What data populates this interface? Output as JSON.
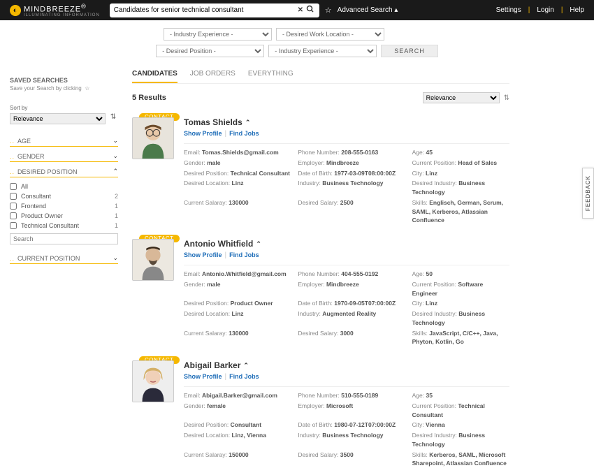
{
  "header": {
    "brand": "MINDBREEZE",
    "tagline": "ILLUMINATING INFORMATION",
    "search_value": "Candidates for senior technical consultant",
    "adv_search": "Advanced Search",
    "nav": {
      "settings": "Settings",
      "login": "Login",
      "help": "Help"
    }
  },
  "filters": {
    "f1": "- Industry Experience -",
    "f2": "- Desired Work Location -",
    "f3": "- Desired Position -",
    "f4": "- Industry Experience -",
    "button": "SEARCH"
  },
  "sidebar": {
    "saved": "SAVED SEARCHES",
    "saved_hint": "Save your Search by clicking",
    "sort_label": "Sort by",
    "sort_value": "Relevance",
    "facets": {
      "age": "AGE",
      "gender": "GENDER",
      "desired": "DESIRED POSITION",
      "current": "CURRENT POSITION"
    },
    "desired_opts": [
      {
        "label": "All",
        "count": ""
      },
      {
        "label": "Consultant",
        "count": "2"
      },
      {
        "label": "Frontend",
        "count": "1"
      },
      {
        "label": "Product Owner",
        "count": "1"
      },
      {
        "label": "Technical Consultant",
        "count": "1"
      }
    ],
    "search_ph": "Search"
  },
  "tabs": {
    "candidates": "CANDIDATES",
    "joborders": "JOB ORDERS",
    "everything": "EVERYTHING"
  },
  "results_header": {
    "count": "5 Results",
    "sort": "Relevance"
  },
  "feedback": "FEEDBACK",
  "contact_badge": "CONTACT",
  "links": {
    "show": "Show Profile",
    "find": "Find Jobs"
  },
  "labels": {
    "email": "Email:",
    "phone": "Phone Number:",
    "age": "Age:",
    "gender": "Gender:",
    "employer": "Employer:",
    "curpos": "Current Position:",
    "despos": "Desired Position:",
    "dob": "Date of Birth:",
    "city": "City:",
    "desloc": "Desired Location:",
    "industry": "Industry:",
    "desind": "Desired Industry:",
    "cursal": "Current Salaray:",
    "dessal": "Desired Salary:",
    "skills": "Skills:"
  },
  "candidates": [
    {
      "name": "Tomas Shields",
      "email": "Tomas.Shields@gmail.com",
      "phone": "208-555-0163",
      "age": "45",
      "gender": "male",
      "employer": "Mindbreeze",
      "curpos": "Head of Sales",
      "despos": "Technical Consultant",
      "dob": "1977-03-09T08:00:00Z",
      "city": "Linz",
      "desloc": "Linz",
      "industry": "Business Technology",
      "desind": "Business Technology",
      "cursal": "130000",
      "dessal": "2500",
      "skills": "Englisch, German, Scrum, SAML, Kerberos, Atlassian Confluence"
    },
    {
      "name": "Antonio Whitfield",
      "email": "Antonio.Whitfield@gmail.com",
      "phone": "404-555-0192",
      "age": "50",
      "gender": "male",
      "employer": "Mindbreeze",
      "curpos": "Software Engineer",
      "despos": "Product Owner",
      "dob": "1970-09-05T07:00:00Z",
      "city": "Linz",
      "desloc": "Linz",
      "industry": "Augmented Reality",
      "desind": "Business Technology",
      "cursal": "130000",
      "dessal": "3000",
      "skills": "JavaScript, C/C++, Java, Phyton, Kotlin, Go"
    },
    {
      "name": "Abigail Barker",
      "email": "Abigail.Barker@gmail.com",
      "phone": "510-555-0189",
      "age": "35",
      "gender": "female",
      "employer": "Microsoft",
      "curpos": "Technical Consultant",
      "despos": "Consultant",
      "dob": "1980-07-12T07:00:00Z",
      "city": "Vienna",
      "desloc": "Linz, Vienna",
      "industry": "Business Technology",
      "desind": "Business Technology",
      "cursal": "150000",
      "dessal": "3500",
      "skills": "Kerberos, SAML, Microsoft Sharepoint, Atlassian Confluence"
    }
  ]
}
